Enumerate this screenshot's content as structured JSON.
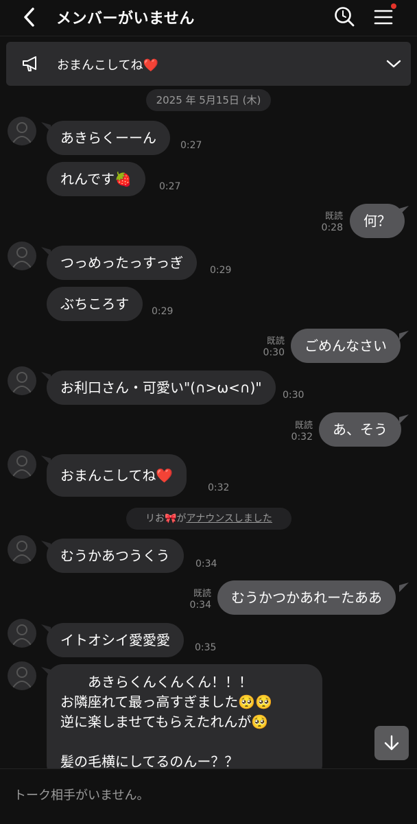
{
  "header": {
    "title": "メンバーがいません"
  },
  "announcement": {
    "text": "おまんこしてね❤️"
  },
  "date_separator": "2025 年 5月15日 (木)",
  "messages": [
    {
      "side": "left",
      "text": "あきらくーーん",
      "time": "0:27"
    },
    {
      "side": "left",
      "text": "れんです🍓",
      "time": "0:27"
    },
    {
      "side": "right",
      "text": "何？",
      "read": "既読",
      "time": "0:28"
    },
    {
      "side": "left",
      "text": "つっめったっすっぎ",
      "time": "0:29"
    },
    {
      "side": "left",
      "text": "ぶちころす",
      "time": "0:29"
    },
    {
      "side": "right",
      "text": "ごめんなさい",
      "read": "既読",
      "time": "0:30"
    },
    {
      "side": "left",
      "text": "お利口さん・可愛い\"(∩>ω<∩)\"",
      "time": "0:30"
    },
    {
      "side": "right",
      "text": "あ、そう",
      "read": "既読",
      "time": "0:32"
    },
    {
      "side": "left",
      "text": "おまんこしてね❤️",
      "time": "0:32"
    },
    {
      "side": "left",
      "text": "むうかあつうくう",
      "time": "0:34"
    },
    {
      "side": "right",
      "text": "むうかつかあれーたああ",
      "read": "既読",
      "time": "0:34"
    },
    {
      "side": "left",
      "text": "イトオシイ愛愛愛",
      "time": "0:35"
    }
  ],
  "system_notice": {
    "prefix": "リお🎀が",
    "link": "アナウンスしました"
  },
  "long_message": {
    "lines": [
      "　　あきらくんくんくん！！！",
      "お隣座れて最っ高すぎました🥺🥺",
      "逆に楽しませてもらえたれんが🥺",
      "",
      "髪の毛横にしてるのんー？？"
    ]
  },
  "footer": {
    "text": "トーク相手がいません。"
  }
}
